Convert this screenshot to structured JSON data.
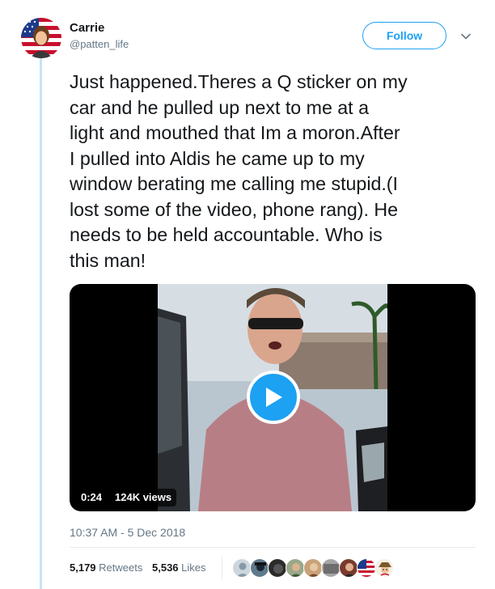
{
  "user": {
    "name": "Carrie",
    "handle": "@patten_life"
  },
  "follow_label": "Follow",
  "tweet": {
    "lines": [
      "Just happened.Theres a Q sticker on my",
      "car and he pulled up next to me at a",
      "light and mouthed that Im a moron.After",
      "I pulled into Aldis he came up to my",
      "window berating me calling me stupid.(I",
      "lost some of the video, phone rang). He",
      "needs to be held accountable. Who is",
      "this man!"
    ]
  },
  "video": {
    "duration": "0:24",
    "views": "124K views"
  },
  "timestamp": "10:37 AM - 5 Dec 2018",
  "stats": {
    "retweets_count": "5,179",
    "retweets_label": "Retweets",
    "likes_count": "5,536",
    "likes_label": "Likes"
  },
  "icons": {
    "caret": "chevron-down-icon",
    "play": "play-icon"
  },
  "colors": {
    "brand_blue": "#1da1f2",
    "muted_text": "#657786",
    "thread_line": "#c4e4f6"
  }
}
